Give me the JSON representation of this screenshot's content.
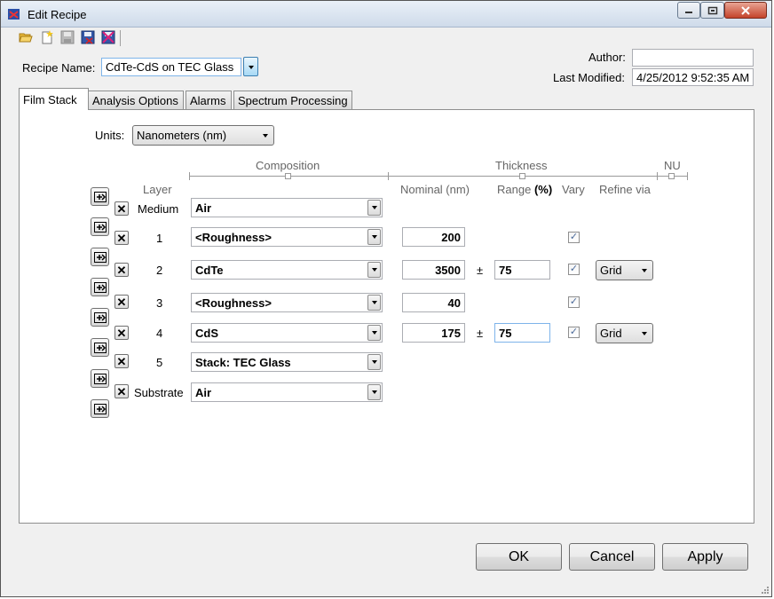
{
  "window": {
    "title": "Edit Recipe",
    "controls": {
      "minimize": "–",
      "maximize": "□",
      "close": "✕"
    }
  },
  "toolbar": {
    "icons": [
      "open-folder-icon",
      "new-icon",
      "save-icon",
      "save-as-icon",
      "delete-icon"
    ]
  },
  "recipe": {
    "name_label": "Recipe Name:",
    "name_value": "CdTe-CdS on TEC Glass",
    "author_label": "Author:",
    "author_value": "",
    "modified_label": "Last Modified:",
    "modified_value": "4/25/2012 9:52:35 AM"
  },
  "tabs": [
    "Film Stack",
    "Analysis Options",
    "Alarms",
    "Spectrum Processing"
  ],
  "units": {
    "label": "Units:",
    "value": "Nanometers (nm)"
  },
  "headers": {
    "composition": "Composition",
    "thickness": "Thickness",
    "nu": "NU",
    "layer": "Layer",
    "nominal": "Nominal (nm)",
    "range": "Range",
    "range_unit": "(%)",
    "vary": "Vary",
    "refine": "Refine via"
  },
  "plusminus": "±",
  "layers": [
    {
      "layer": "Medium",
      "composition": "Air"
    },
    {
      "layer": "1",
      "composition": "<Roughness>",
      "nominal": "200",
      "vary": true
    },
    {
      "layer": "2",
      "composition": "CdTe",
      "nominal": "3500",
      "range": "75",
      "vary": true,
      "refine": "Grid"
    },
    {
      "layer": "3",
      "composition": "<Roughness>",
      "nominal": "40",
      "vary": true
    },
    {
      "layer": "4",
      "composition": "CdS",
      "nominal": "175",
      "range": "75",
      "vary": true,
      "refine": "Grid"
    },
    {
      "layer": "5",
      "composition": "Stack: TEC Glass"
    },
    {
      "layer": "Substrate",
      "composition": "Air"
    }
  ],
  "buttons": {
    "ok": "OK",
    "cancel": "Cancel",
    "apply": "Apply"
  }
}
